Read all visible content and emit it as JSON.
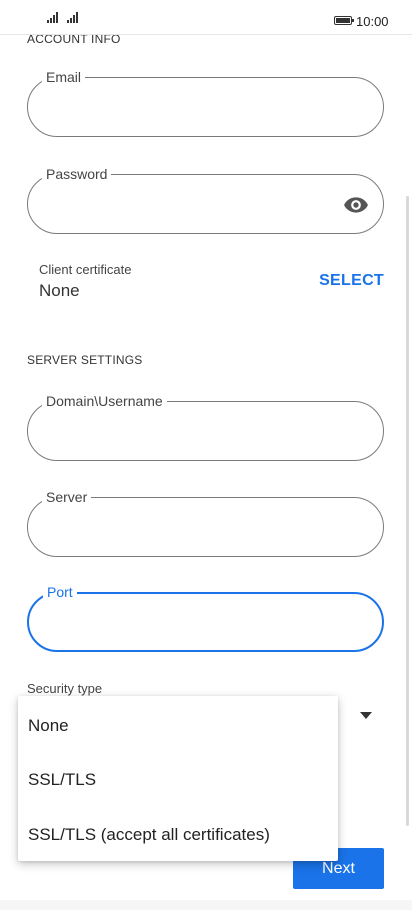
{
  "status_bar": {
    "time": "10:00"
  },
  "account_info": {
    "title": "ACCOUNT INFO",
    "email_label": "Email",
    "email_value": "",
    "password_label": "Password",
    "password_value": "",
    "client_certificate_label": "Client certificate",
    "client_certificate_value": "None",
    "select_label": "SELECT"
  },
  "server_settings": {
    "title": "SERVER SETTINGS",
    "domain_username_label": "Domain\\Username",
    "domain_username_value": "",
    "server_label": "Server",
    "server_value": "",
    "port_label": "Port",
    "port_value": "",
    "security_type_label": "Security type"
  },
  "security_menu": {
    "items": [
      "None",
      "SSL/TLS",
      "SSL/TLS (accept all certificates)"
    ]
  },
  "footer": {
    "next_label": "Next"
  },
  "colors": {
    "accent": "#1a73e8",
    "border": "#7a7a7a"
  },
  "icons": [
    "signal-icon",
    "battery-icon",
    "eye-icon",
    "dropdown-arrow-icon"
  ]
}
